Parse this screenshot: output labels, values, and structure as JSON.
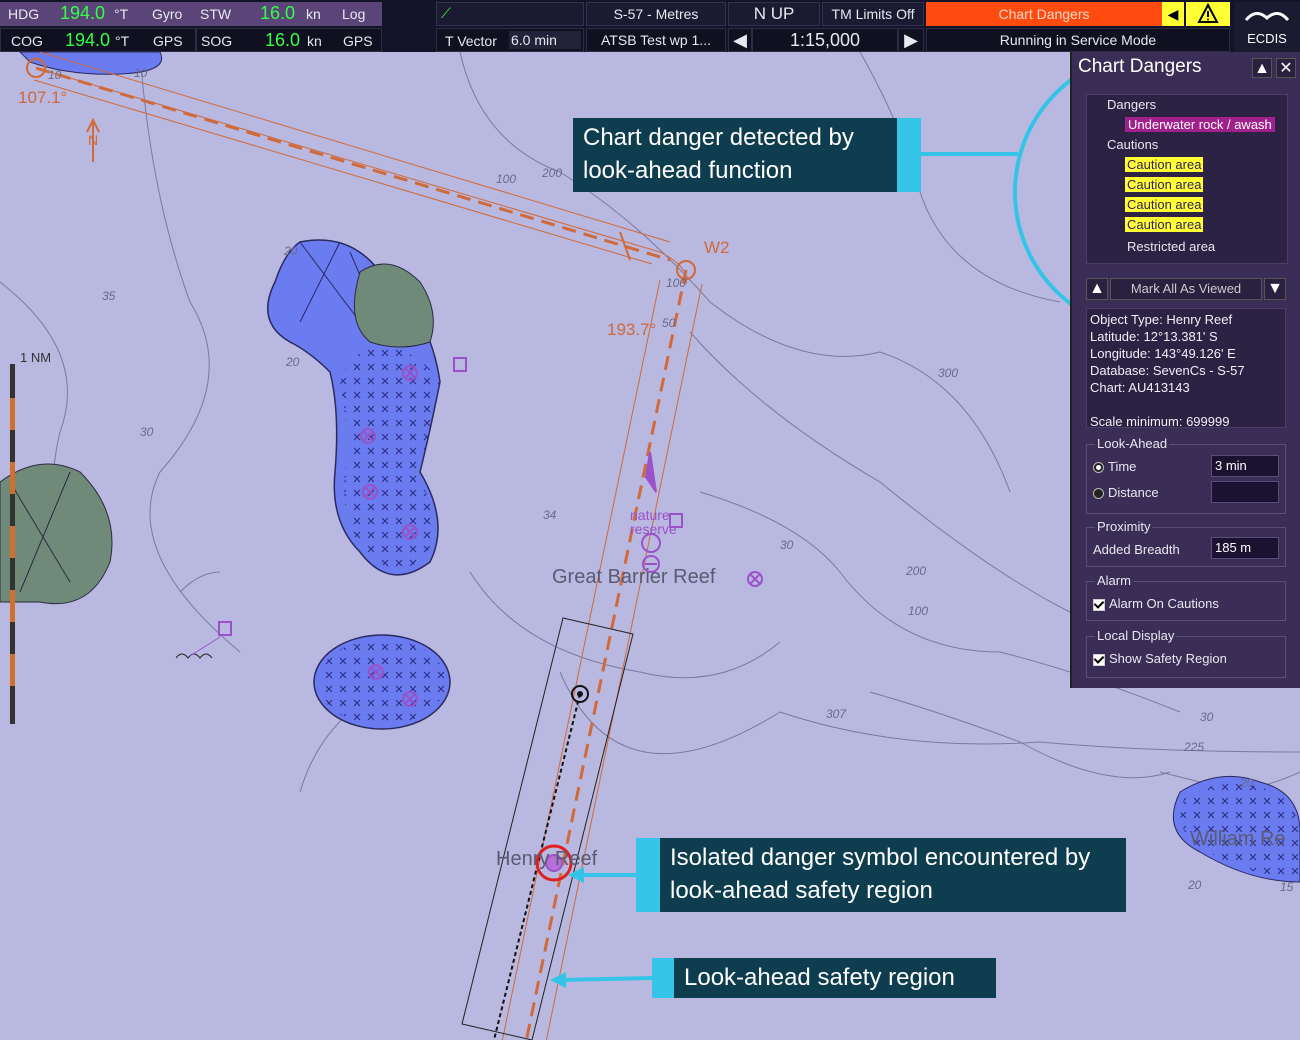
{
  "top_bar": {
    "row1": {
      "hdg_label": "HDG",
      "hdg_value": "194.0",
      "hdg_unit": "°T",
      "hdg_source": "Gyro",
      "stw_label": "STW",
      "stw_value": "16.0",
      "stw_unit": "kn",
      "stw_source": "Log",
      "chart_standard": "S-57 - Metres",
      "orientation": "N UP",
      "tm_limits": "TM Limits Off",
      "alert": "Chart Dangers"
    },
    "row2": {
      "cog_label": "COG",
      "cog_value": "194.0",
      "cog_unit": "°T",
      "cog_source": "GPS",
      "sog_label": "SOG",
      "sog_value": "16.0",
      "sog_unit": "kn",
      "sog_source": "GPS",
      "vector_label": "T Vector",
      "vector_value": "6.0 min",
      "route_name": "ATSB Test wp 1...",
      "scale": "1:15,000",
      "mode": "Running in Service Mode"
    },
    "logo_text": "ECDIS"
  },
  "panel": {
    "title": "Chart Dangers",
    "tree": {
      "dangers_label": "Dangers",
      "danger_item": "Underwater rock / awash",
      "cautions_label": "Cautions",
      "caution_items": [
        "Caution area",
        "Caution area",
        "Caution area",
        "Caution area"
      ],
      "restricted_item": "Restricted area"
    },
    "mark_all_label": "Mark All As Viewed",
    "details": [
      "Object Type: Henry Reef",
      "Latitude: 12°13.381' S",
      "Longitude: 143°49.126' E",
      "Database: SevenCs - S-57",
      "Chart: AU413143",
      "",
      "Scale minimum: 699999"
    ],
    "look_ahead": {
      "label": "Look-Ahead",
      "time_label": "Time",
      "time_value": "3 min",
      "distance_label": "Distance",
      "distance_value": ""
    },
    "proximity": {
      "label": "Proximity",
      "breadth_label": "Added Breadth",
      "breadth_value": "185 m"
    },
    "alarm": {
      "label": "Alarm",
      "option": "Alarm On Cautions"
    },
    "local_display": {
      "label": "Local Display",
      "option": "Show Safety Region"
    }
  },
  "map": {
    "waypoint": "W2",
    "course_1": "107.1°",
    "course_2": "193.7°",
    "scale_bar": "1 NM",
    "north": "N",
    "reef_main": "Great Barrier Reef",
    "reef_henry": "Henry Reef",
    "reef_william": "William Re",
    "nature_reserve": "nature reserve",
    "depths": [
      "35",
      "20",
      "20",
      "30",
      "34",
      "200",
      "100",
      "300",
      "30",
      "200",
      "100",
      "307",
      "30",
      "225",
      "20",
      "20",
      "15",
      "10",
      "10",
      "50",
      "100"
    ]
  },
  "callouts": {
    "top": "Chart danger detected by look-ahead function",
    "middle": "Isolated danger symbol encountered by look-ahead safety region",
    "bottom": "Look-ahead safety region"
  },
  "colors": {
    "sea": "#b8b8e0",
    "reef": "#6a7cf0",
    "land": "#708a7a",
    "route": "#d06a3a",
    "alert": "#ff4a10",
    "accent": "#33c4e8",
    "callout_bg": "#0e3d4f"
  }
}
